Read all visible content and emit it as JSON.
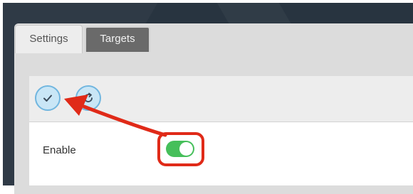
{
  "tabs": [
    {
      "label": "Settings",
      "active": true
    },
    {
      "label": "Targets",
      "active": false
    }
  ],
  "toolbar": {
    "apply_icon": "check-icon",
    "refresh_icon": "refresh-icon"
  },
  "settings": {
    "enable_label": "Enable",
    "enable_on": true
  },
  "colors": {
    "toggle_on": "#46bf5a",
    "annotation": "#e02a18",
    "button_fill": "#c9e6f6",
    "button_border": "#71b6df"
  }
}
